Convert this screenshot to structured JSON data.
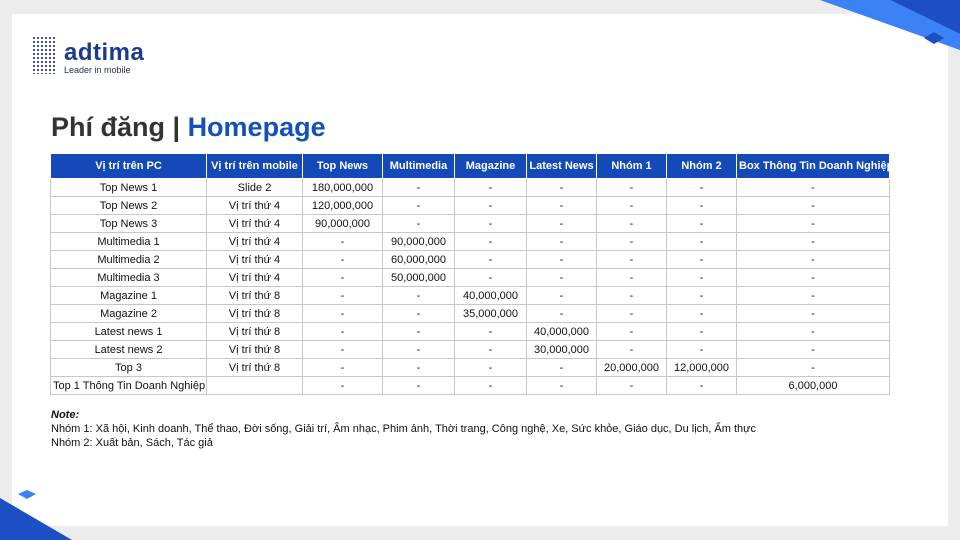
{
  "brand": {
    "name": "adtima",
    "tagline": "Leader in mobile",
    "color": "#1e3a8a"
  },
  "colors": {
    "header_bg": "#1549b8",
    "title_accent": "#1451b8",
    "corner_light": "#3b82f6",
    "corner_dark": "#1d4fc4"
  },
  "title": {
    "part1": "Phí đăng | ",
    "part2": "Homepage"
  },
  "table": {
    "headers": [
      "Vị trí trên PC",
      "Vị trí trên mobile",
      "Top News",
      "Multimedia",
      "Magazine",
      "Latest News",
      "Nhóm 1",
      "Nhóm 2",
      "Box Thông Tin Doanh Nghiệp"
    ],
    "rows": [
      [
        "Top News 1",
        "Slide 2",
        "180,000,000",
        "-",
        "-",
        "-",
        "-",
        "-",
        "-"
      ],
      [
        "Top News 2",
        "Vị trí thứ 4",
        "120,000,000",
        "-",
        "-",
        "-",
        "-",
        "-",
        "-"
      ],
      [
        "Top News 3",
        "Vị trí thứ 4",
        "90,000,000",
        "-",
        "-",
        "-",
        "-",
        "-",
        "-"
      ],
      [
        "Multimedia 1",
        "Vị trí thứ 4",
        "-",
        "90,000,000",
        "-",
        "-",
        "-",
        "-",
        "-"
      ],
      [
        "Multimedia 2",
        "Vị trí thứ 4",
        "-",
        "60,000,000",
        "-",
        "-",
        "-",
        "-",
        "-"
      ],
      [
        "Multimedia 3",
        "Vị trí thứ 4",
        "-",
        "50,000,000",
        "-",
        "-",
        "-",
        "-",
        "-"
      ],
      [
        "Magazine 1",
        "Vị trí thứ 8",
        "-",
        "-",
        "40,000,000",
        "-",
        "-",
        "-",
        "-"
      ],
      [
        "Magazine 2",
        "Vị trí thứ 8",
        "-",
        "-",
        "35,000,000",
        "-",
        "-",
        "-",
        "-"
      ],
      [
        "Latest news 1",
        "Vị trí thứ 8",
        "-",
        "-",
        "-",
        "40,000,000",
        "-",
        "-",
        "-"
      ],
      [
        "Latest news 2",
        "Vị trí thứ 8",
        "-",
        "-",
        "-",
        "30,000,000",
        "-",
        "-",
        "-"
      ],
      [
        "Top 3",
        "Vị trí thứ 8",
        "-",
        "-",
        "-",
        "-",
        "20,000,000",
        "12,000,000",
        "-"
      ],
      [
        "Top 1 Thông Tin Doanh Nghiệp",
        "",
        "-",
        "-",
        "-",
        "-",
        "-",
        "-",
        "6,000,000"
      ]
    ]
  },
  "note": {
    "heading": "Note:",
    "lines": [
      "Nhóm 1: Xã hội, Kinh doanh, Thể thao, Đời sống, Giải trí, Âm nhạc, Phim ảnh, Thời trang, Công nghệ, Xe, Sức khỏe, Giáo dục, Du lịch, Ẩm thực",
      "Nhóm 2: Xuất bản, Sách, Tác giả"
    ]
  }
}
